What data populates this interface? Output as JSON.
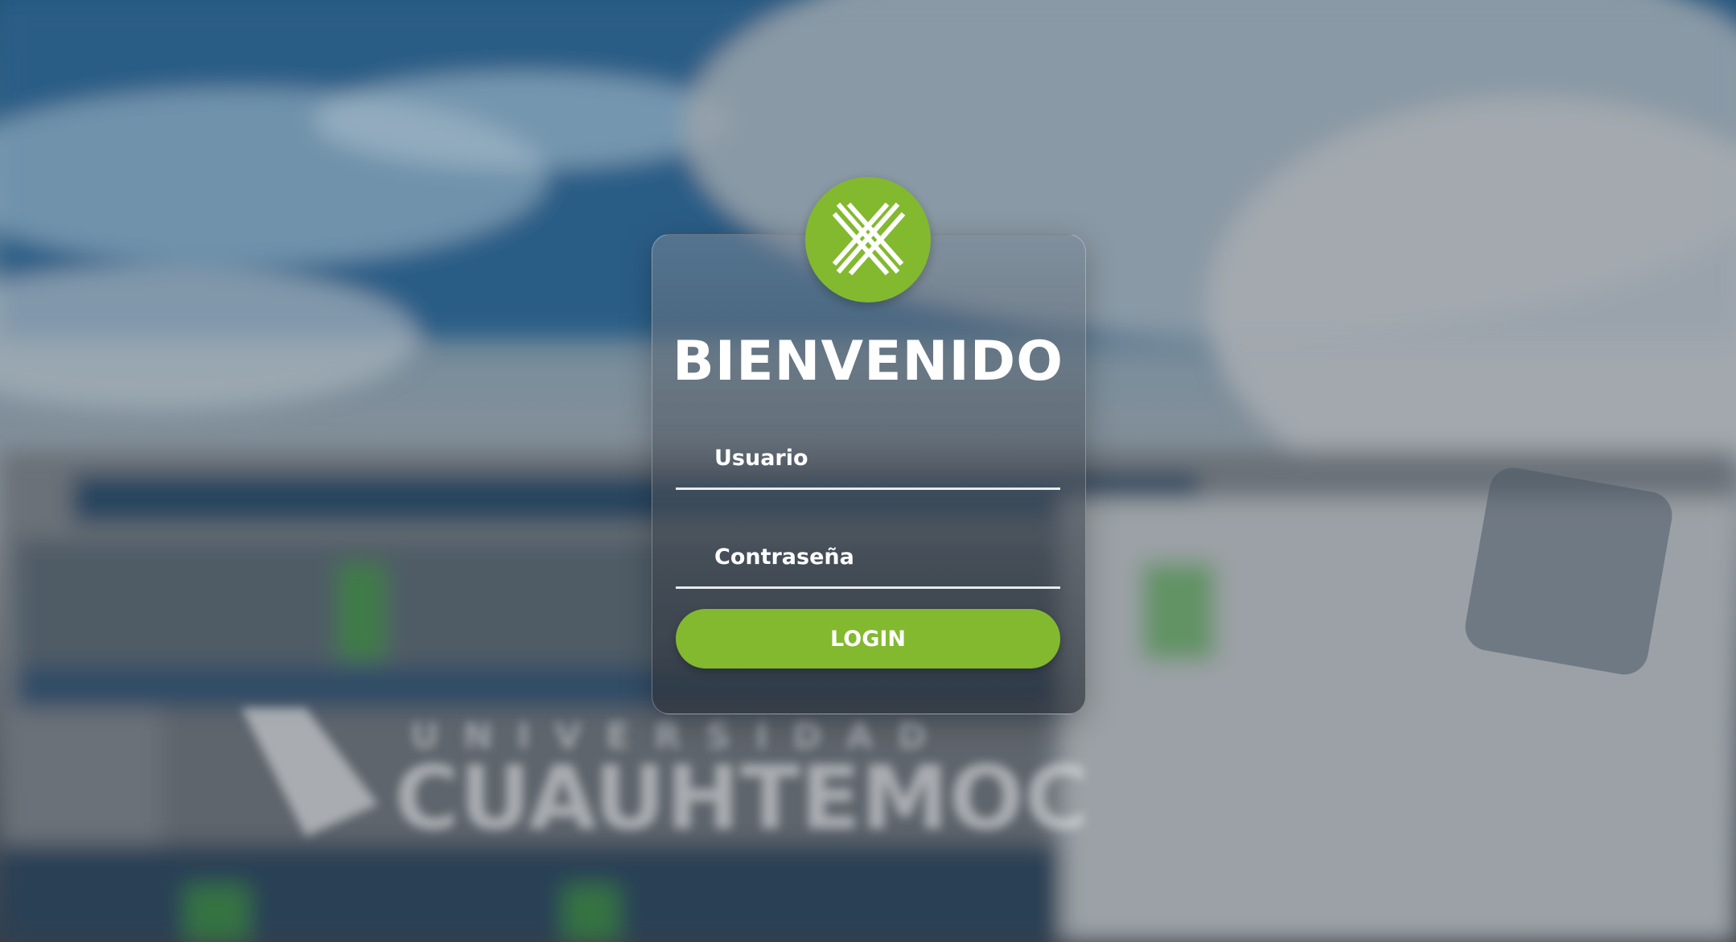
{
  "page": {
    "title": "BIENVENIDO"
  },
  "logo": {
    "icon": "x-logo-icon",
    "brand_color": "#83b92f"
  },
  "form": {
    "username_placeholder": "Usuario",
    "password_placeholder": "Contraseña",
    "login_label": "LOGIN"
  },
  "background": {
    "sign_text": "CUAUHTEMOC",
    "sign_subtext": "UNIVERSIDAD"
  },
  "colors": {
    "accent": "#83b92f",
    "text": "#ffffff"
  }
}
